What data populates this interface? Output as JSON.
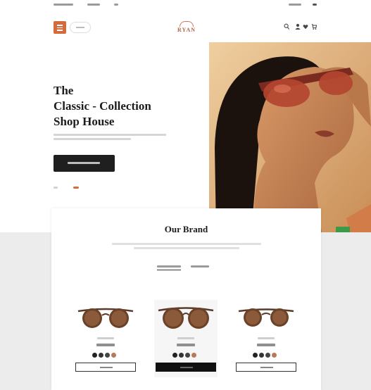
{
  "header": {
    "logo_text": "RYAN",
    "colors": {
      "accent": "#d56a3a",
      "logo": "#b0674a"
    },
    "icons": [
      "menu-icon",
      "search-icon",
      "user-icon",
      "heart-icon",
      "cart-icon"
    ]
  },
  "hero": {
    "title_line1": "The",
    "title_line2": "Classic - Collection",
    "title_line3": "Shop House",
    "slide_count": 2,
    "active_slide": 2
  },
  "brand": {
    "title": "Our Brand",
    "active_tab": 1,
    "products": [
      {
        "swatch_colors": [
          "#222222",
          "#333333",
          "#444444",
          "#b47a5a"
        ],
        "button_style": "outline"
      },
      {
        "swatch_colors": [
          "#222222",
          "#333333",
          "#444444",
          "#b47a5a"
        ],
        "button_style": "filled"
      },
      {
        "swatch_colors": [
          "#222222",
          "#333333",
          "#444444",
          "#b47a5a"
        ],
        "button_style": "outline"
      }
    ]
  },
  "colors": {
    "hero_image_bg": "#e3b783",
    "band": "#ececec",
    "button_dark": "#1f1f1f"
  }
}
